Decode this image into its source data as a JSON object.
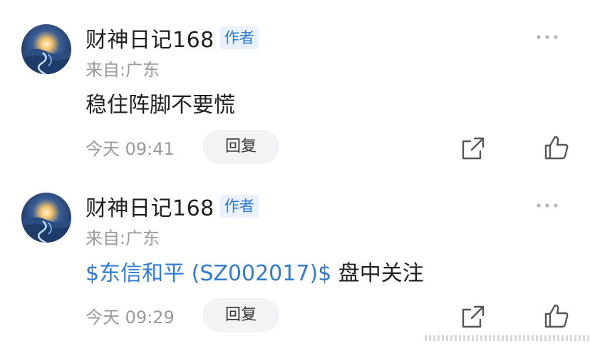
{
  "colors": {
    "accent": "#2f7bd6",
    "badge_bg": "#e8f1fc",
    "muted_text": "#9a9a9a",
    "reply_bg": "#f2f3f5"
  },
  "comments": [
    {
      "username": "财神日记168",
      "badge": "作者",
      "location": "来自:广东",
      "body": {
        "stock_link": "",
        "text": "稳住阵脚不要慌"
      },
      "timestamp": "今天 09:41",
      "reply_label": "回复",
      "icons": [
        "avatar-image",
        "more-dots-icon",
        "share-icon",
        "thumbs-up-icon"
      ]
    },
    {
      "username": "财神日记168",
      "badge": "作者",
      "location": "来自:广东",
      "body": {
        "stock_link": "$东信和平 (SZ002017)$",
        "text": " 盘中关注"
      },
      "timestamp": "今天 09:29",
      "reply_label": "回复",
      "icons": [
        "avatar-image",
        "more-dots-icon",
        "share-icon",
        "thumbs-up-icon"
      ]
    }
  ]
}
